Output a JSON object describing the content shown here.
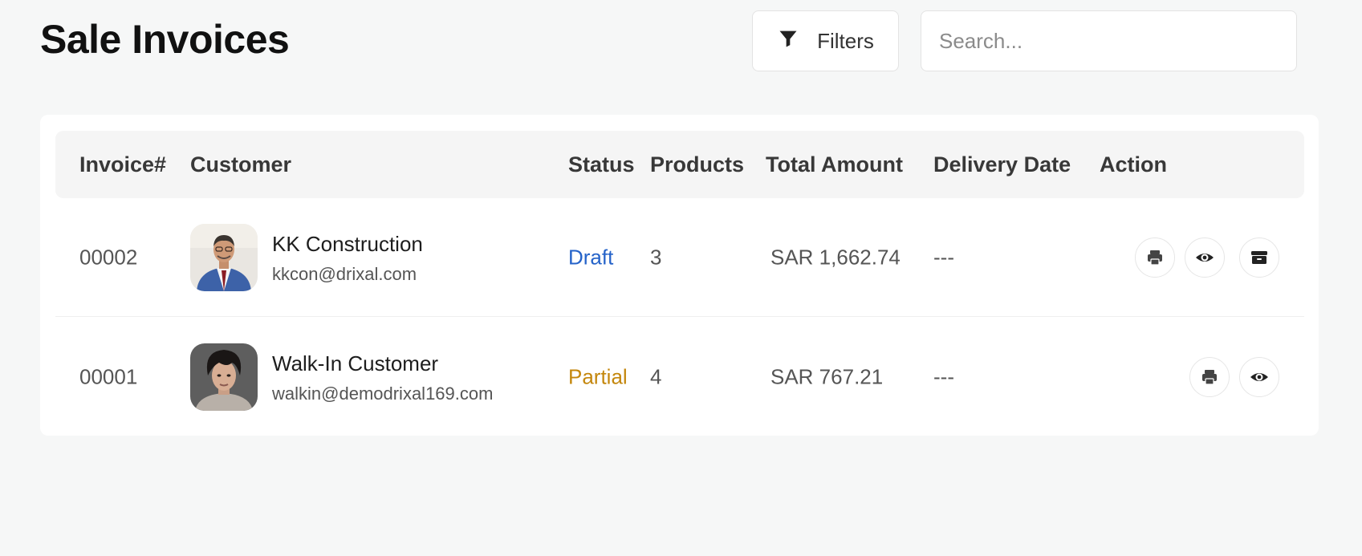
{
  "header": {
    "title": "Sale Invoices",
    "filters_label": "Filters",
    "search_placeholder": "Search..."
  },
  "table": {
    "columns": [
      "Invoice#",
      "Customer",
      "Status",
      "Products",
      "Total Amount",
      "Delivery Date",
      "Action"
    ],
    "rows": [
      {
        "invoice": "00002",
        "customer_name": "KK Construction",
        "customer_email": "kkcon@drixal.com",
        "status": "Draft",
        "products": "3",
        "total": "SAR 1,662.74",
        "delivery_date": "---",
        "actions": [
          "print-icon",
          "view-icon",
          "archive-icon"
        ]
      },
      {
        "invoice": "00001",
        "customer_name": "Walk-In Customer",
        "customer_email": "walkin@demodrixal169.com",
        "status": "Partial",
        "products": "4",
        "total": "SAR 767.21",
        "delivery_date": "---",
        "actions": [
          "print-icon",
          "view-icon"
        ]
      }
    ]
  },
  "colors": {
    "status_draft": "#2563c9",
    "status_partial": "#c4870d",
    "page_background": "#f6f7f7"
  }
}
